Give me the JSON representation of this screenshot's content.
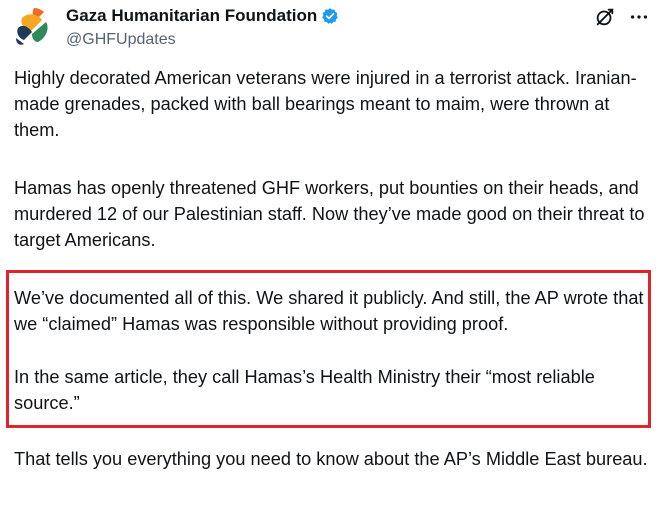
{
  "author": {
    "name": "Gaza Humanitarian Foundation",
    "handle": "@GHFUpdates",
    "avatar_icon": "ghf-logo",
    "verified_icon": "verified-badge-icon",
    "verified_color": "#1d9bf0"
  },
  "actions": {
    "grok_icon": "grok-icon",
    "more_icon": "more-options-icon"
  },
  "post": {
    "paragraphs": [
      "Highly decorated American veterans were injured in a terrorist attack. Iranian-made grenades, packed with ball bearings meant to maim, were thrown at them.",
      "Hamas has openly threatened GHF workers, put bounties on their heads, and murdered 12 of our Palestinian staff. Now they’ve made good on their threat to target Americans.",
      "We’ve documented all of this. We shared it publicly. And still, the AP wrote that we “claimed” Hamas was responsible without providing proof.",
      "In the same article, they call Hamas’s Health Ministry their “most reliable source.”",
      "That tells you everything you need to know about the AP’s Middle East bureau."
    ]
  },
  "colors": {
    "text": "#0f1419",
    "secondary_text": "#536471",
    "highlight_border": "#e0242b"
  }
}
